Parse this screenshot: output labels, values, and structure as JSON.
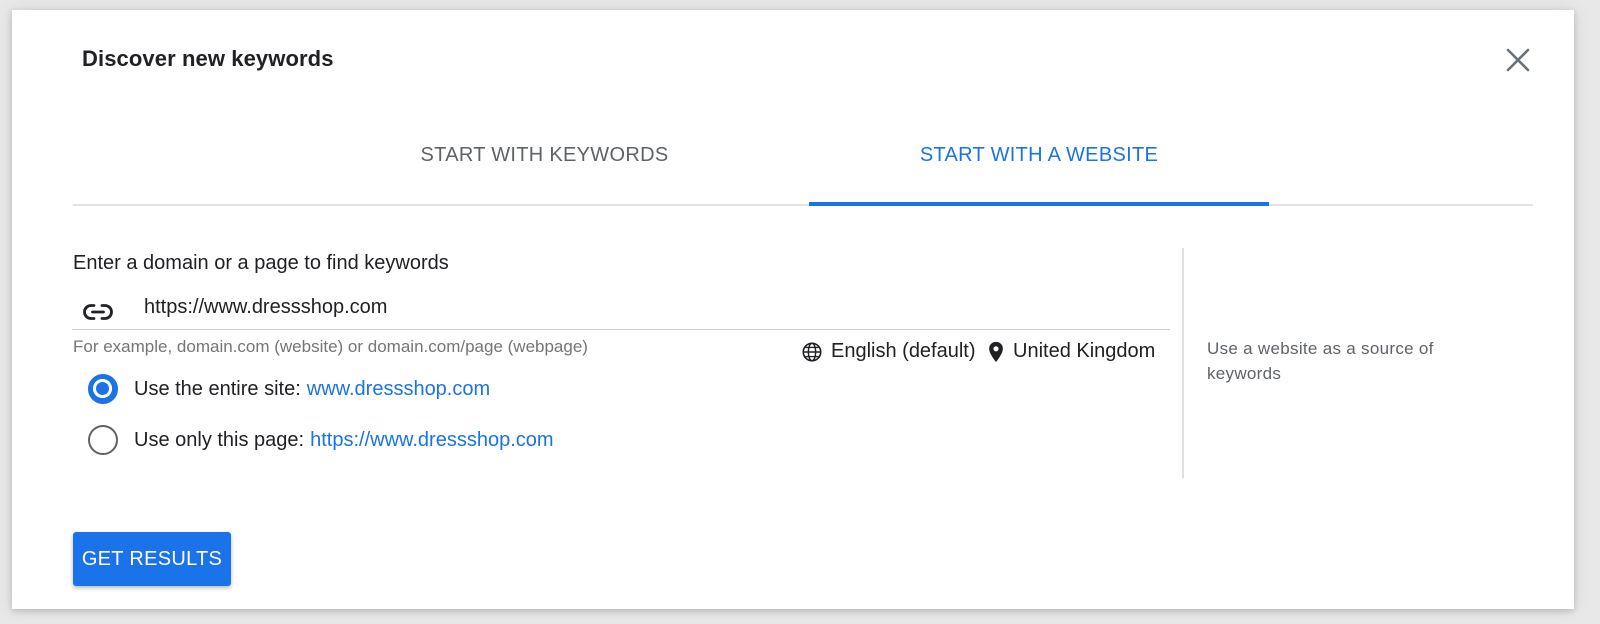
{
  "dialog": {
    "title": "Discover new keywords",
    "close_icon": "close-icon"
  },
  "tabs": [
    {
      "label": "START WITH KEYWORDS",
      "active": false
    },
    {
      "label": "START WITH A WEBSITE",
      "active": true
    }
  ],
  "website_form": {
    "label": "Enter a domain or a page to find keywords",
    "input_icon": "link-icon",
    "input_value": "https://www.dressshop.com",
    "hint": "For example, domain.com (website) or domain.com/page (webpage)",
    "language": {
      "icon": "globe-icon",
      "label": "English (default)"
    },
    "location": {
      "icon": "location-pin-icon",
      "label": "United Kingdom"
    },
    "options": [
      {
        "prefix": "Use the entire site:",
        "url": "www.dressshop.com",
        "checked": true
      },
      {
        "prefix": "Use only this page:",
        "url": "https://www.dressshop.com",
        "checked": false
      }
    ]
  },
  "side_panel": {
    "text": "Use a website as a source of keywords"
  },
  "actions": {
    "get_results_label": "GET RESULTS"
  },
  "colors": {
    "accent": "#1a73e8",
    "text": "#202124",
    "muted": "#5f6368"
  }
}
